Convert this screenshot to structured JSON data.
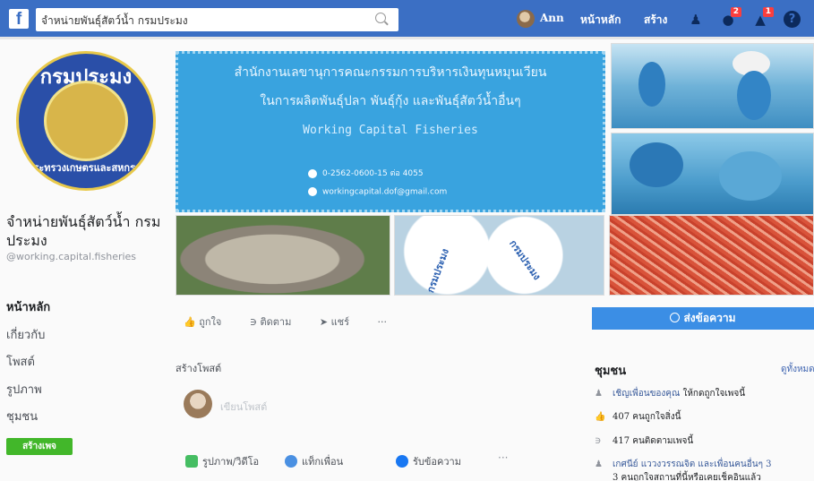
{
  "topbar": {
    "logo": "f",
    "search_value": "จำหน่ายพันธุ์สัตว์น้ำ กรมประมง",
    "user_name": "Ann",
    "home_label": "หน้าหลัก",
    "create_label": "สร้าง",
    "friend_requests_icon": "friends-icon",
    "messages_count": "2",
    "notifications_count": "1",
    "help_icon": "?",
    "brand_color": "#3b6fc4"
  },
  "profile": {
    "logo_text_top": "กรมประมง",
    "logo_text_bottom": "กระทรวงเกษตรและสหกรณ์",
    "page_name": "จำหน่ายพันธุ์สัตว์น้ำ กรมประมง",
    "handle": "@working.capital.fisheries"
  },
  "nav": {
    "items": [
      {
        "label": "หน้าหลัก",
        "active": true
      },
      {
        "label": "เกี่ยวกับ"
      },
      {
        "label": "โพสต์"
      },
      {
        "label": "รูปภาพ"
      },
      {
        "label": "ชุมชน"
      }
    ],
    "create_page": "สร้างเพจ"
  },
  "cover": {
    "line1": "สำนักงานเลขานุการคณะกรรมการบริหารเงินทุนหมุนเวียน",
    "line2": "ในการผลิตพันธุ์ปลา พันธุ์กุ้ง และพันธุ์สัตว์น้ำอื่นๆ",
    "line3": "Working Capital Fisheries",
    "phone": "0-2562-0600-15 ต่อ 4055",
    "email": "workingcapital.dof@gmail.com",
    "bag_label_1": "กรมประมง",
    "bag_label_2": "กรมประมง"
  },
  "actions": {
    "like": "ถูกใจ",
    "follow": "ติดตาม",
    "share": "แชร์",
    "more": "···",
    "send_message": "ส่งข้อความ"
  },
  "create_post": {
    "title": "สร้างโพสต์",
    "placeholder": "เขียนโพสต์",
    "photo_video": "รูปภาพ/วิดีโอ",
    "tag_friends": "แท็กเพื่อน",
    "get_messages": "รับข้อความ",
    "more": "···"
  },
  "community": {
    "title": "ชุมชน",
    "see_all": "ดูทั้งหมด",
    "invite_link": "เชิญเพื่อนของคุณ",
    "invite_rest": " ให้กดถูกใจเพจนี้",
    "likes": "407 คนถูกใจสิ่งนี้",
    "follows": "417 คนติดตามเพจนี้",
    "friend_link": "เกศนีย์ แววงวรรณจิต และเพื่อนคนอื่นๆ 3",
    "friend_rest": "3 คนถูกใจสถานที่นี้หรือเคยเช็คอินแล้ว"
  }
}
